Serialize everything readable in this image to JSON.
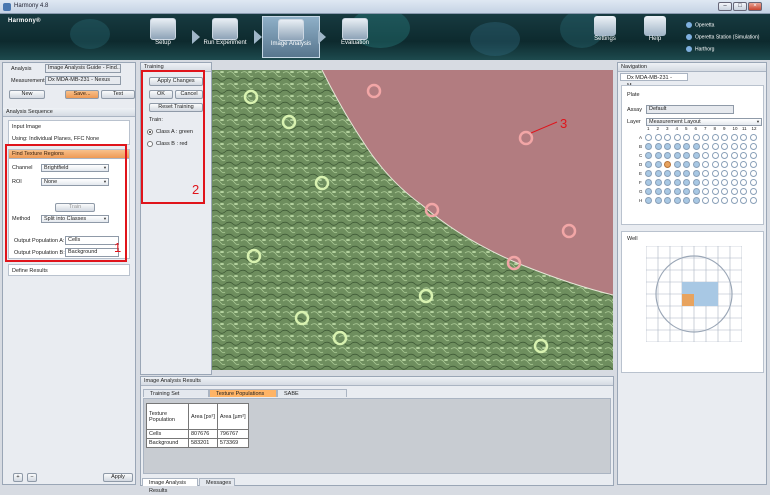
{
  "window": {
    "title": "Harmony 4.8",
    "controls": [
      "–",
      "□",
      "×"
    ]
  },
  "ribbon": {
    "logo": "Harmony",
    "logo_mark": "®",
    "workflow": [
      {
        "label": "Setup",
        "icon": "setup-icon"
      },
      {
        "label": "Run Experiment",
        "icon": "run-experiment-icon"
      },
      {
        "label": "Image Analysis",
        "icon": "image-analysis-icon",
        "active": true
      },
      {
        "label": "Evaluation",
        "icon": "evaluation-icon"
      }
    ],
    "settings": "Settings",
    "help": "Help",
    "links": [
      "Operetta",
      "Operetta Station (Simulation)",
      "Harthorg"
    ]
  },
  "left": {
    "analysis_label": "Analysis",
    "analysis_value": "Image Analysis Guide - Find...",
    "measurement_label": "Measurement",
    "measurement_value": "Dx MDA-MB-231 - Nexus",
    "new_btn": "New",
    "save_btn": "Save...",
    "text_btn": "Text",
    "sequence_header": "Analysis Sequence",
    "input_image": "Input Image",
    "input_sub": "Using: Individual Planes, FFC None",
    "texture_header": "Find Texture Regions",
    "channel_label": "Channel",
    "channel_value": "Brightfield",
    "roi_label": "ROI",
    "roi_value": "None",
    "train_btn": "Train",
    "method_label": "Method",
    "method_value": "Split into Classes",
    "out_a_label": "Output Population A:",
    "out_a_value": "Cells",
    "out_b_label": "Output Population B:",
    "out_b_value": "Background",
    "define_results": "Define Results",
    "apply_btn": "Apply"
  },
  "training": {
    "header": "Training",
    "apply_changes": "Apply Changes",
    "ok": "OK",
    "cancel": "Cancel",
    "reset": "Reset Training",
    "train_label": "Train:",
    "class_a": "Class A : green",
    "class_b": "Class B : red"
  },
  "annotations": {
    "n1": "1",
    "n2": "2",
    "n3": "3"
  },
  "results": {
    "header": "Image Analysis Results",
    "tabs": [
      "Training Set",
      "Texture Populations",
      "SABE"
    ],
    "columns": [
      "Texture Population",
      "Area [px²]",
      "Area [µm²]"
    ],
    "rows": [
      [
        "Cells",
        "807676",
        "796767"
      ],
      [
        "Background",
        "583201",
        "573369"
      ]
    ],
    "bottom_tabs": [
      "Image Analysis Results",
      "Messages"
    ]
  },
  "navigation": {
    "header": "Navigation",
    "plate_tab": "Dx MDA-MB-231 - M...",
    "plate_title": "Plate",
    "assay_label": "Assay",
    "assay_value": "Default",
    "layer_label": "Layer",
    "layer_value": "Measurement Layout",
    "cols": [
      "1",
      "2",
      "3",
      "4",
      "5",
      "6",
      "7",
      "8",
      "9",
      "10",
      "11",
      "12"
    ],
    "rows": [
      "A",
      "B",
      "C",
      "D",
      "E",
      "F",
      "G",
      "H"
    ],
    "well_title": "Well"
  },
  "colors": {
    "accent_orange": "#ee9a55",
    "annotation_red": "#e0141b",
    "well_blue": "#a8c8e4"
  }
}
